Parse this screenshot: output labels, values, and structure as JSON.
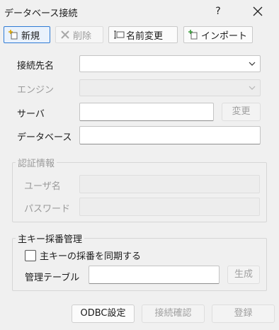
{
  "window": {
    "title": "データベース接続",
    "help": "?",
    "close": "✕"
  },
  "toolbar": {
    "new_label": "新規",
    "delete_label": "削除",
    "rename_label": "名前変更",
    "import_label": "インポート"
  },
  "form": {
    "connection_name_label": "接続先名",
    "connection_name_value": "",
    "engine_label": "エンジン",
    "engine_value": "",
    "server_label": "サーバ",
    "server_value": "",
    "change_label": "変更",
    "database_label": "データベース",
    "database_value": ""
  },
  "auth": {
    "group_label": "認証情報",
    "user_label": "ユーザ名",
    "user_value": "",
    "password_label": "パスワード",
    "password_value": ""
  },
  "pk": {
    "group_label": "主キー採番管理",
    "sync_checkbox_label": "主キーの採番を同期する",
    "sync_checked": false,
    "table_label": "管理テーブル",
    "table_value": "",
    "generate_label": "生成"
  },
  "footer": {
    "odbc_label": "ODBC設定",
    "test_label": "接続確認",
    "register_label": "登録"
  }
}
